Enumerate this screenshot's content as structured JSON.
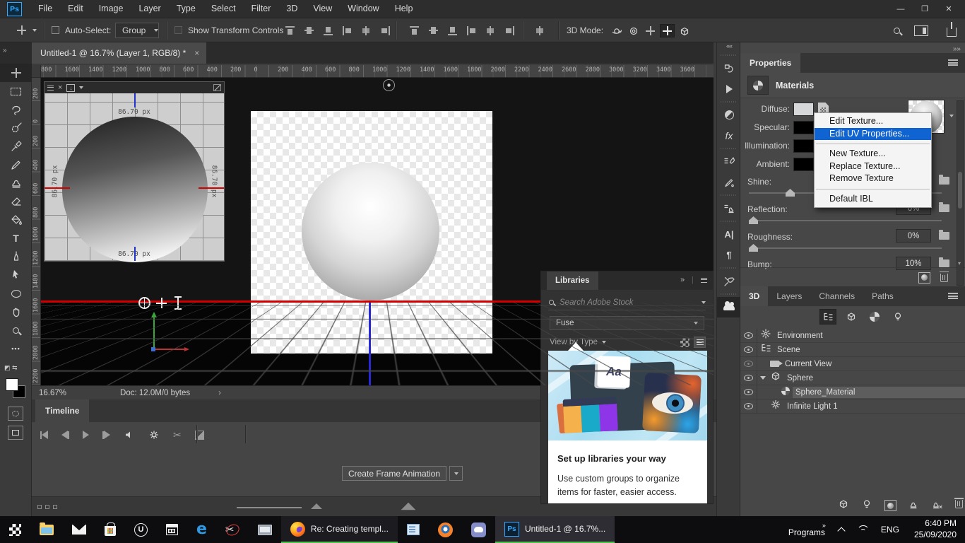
{
  "colors": {
    "menu_highlight_blue": "#0f64d2",
    "taskbar_active_green": "#51c251",
    "photoshop_accent": "#31a8ff",
    "horizon_line_red": "#cf0000",
    "axis_line_blue": "#2828d8"
  },
  "menubar": {
    "logo": "Ps",
    "items": [
      "File",
      "Edit",
      "Image",
      "Layer",
      "Type",
      "Select",
      "Filter",
      "3D",
      "View",
      "Window",
      "Help"
    ],
    "window_controls": [
      "minimize",
      "restore",
      "close"
    ]
  },
  "options_bar": {
    "tool_icon": "move-tool",
    "auto_select_label": "Auto-Select:",
    "auto_select_checked": false,
    "group_value": "Group",
    "show_transform_label": "Show Transform Controls",
    "show_transform_enabled": false,
    "align_icons": [
      "align-top-edges",
      "align-vertical-centers",
      "align-bottom-edges",
      "align-left-edges",
      "align-horizontal-centers",
      "align-right-edges"
    ],
    "distribute_icons": [
      "distribute-top-edges",
      "distribute-vertical-centers",
      "distribute-bottom-edges",
      "distribute-left-edges",
      "distribute-horizontal-centers",
      "distribute-right-edges"
    ],
    "spacing_icon": "distribute-spacing",
    "mode_label": "3D Mode:",
    "mode_icons": [
      "orbit-camera",
      "roll-camera",
      "pan-camera",
      "slide-camera",
      "dolly-camera"
    ],
    "mode_selected": "slide-camera"
  },
  "document_tab": {
    "title": "Untitled-1 @ 16.7% (Layer 1, RGB/8) *",
    "close_glyph": "×"
  },
  "rulers": {
    "horizontal": [
      "800",
      "1600",
      "1400",
      "1200",
      "1000",
      "800",
      "600",
      "400",
      "200",
      "0",
      "200",
      "400",
      "600",
      "800",
      "1000",
      "1200",
      "1400",
      "1600",
      "1800",
      "2000",
      "2200",
      "2400",
      "2600",
      "2800",
      "3000",
      "3200",
      "3400",
      "3600"
    ],
    "vertical": [
      "200",
      "0",
      "200",
      "400",
      "600",
      "800",
      "1000",
      "1200",
      "1400",
      "1600",
      "1800",
      "2000",
      "2200"
    ]
  },
  "toolbar": {
    "tools": [
      "move",
      "rectangular-marquee",
      "lasso",
      "quick-selection",
      "eyedropper",
      "brush",
      "clone-stamp",
      "eraser",
      "paint-bucket",
      "type",
      "pen",
      "path-selection",
      "ellipse",
      "hand",
      "zoom",
      "edit-toolbar"
    ],
    "selected": "move"
  },
  "uv_view": {
    "dim_top": "86.70 px",
    "dim_bottom": "86.70 px",
    "dim_left": "86.70 px",
    "dim_right": "86.70 px"
  },
  "status_bar": {
    "zoom_level": "16.67%",
    "doc_info": "Doc: 12.0M/0 bytes",
    "chevron": "›"
  },
  "timeline_panel": {
    "tab": "Timeline",
    "transport": [
      "first-frame",
      "previous-frame",
      "play",
      "next-frame",
      "mute-audio",
      "settings",
      "split",
      "transition"
    ],
    "create_button_label": "Create Frame Animation"
  },
  "dock_icons": [
    "history",
    "actions",
    "adjustments",
    "styles",
    "brush-settings",
    "brushes",
    "clone-source",
    "character",
    "paragraph",
    "tool-presets",
    "creative-cloud"
  ],
  "properties_panel": {
    "tab": "Properties",
    "section_title": "Materials",
    "material_rows": [
      {
        "label": "Diffuse:",
        "swatch": "#d6d7d9",
        "has_texture_button": true
      },
      {
        "label": "Specular:",
        "swatch": "#000000",
        "has_texture_button": false
      },
      {
        "label": "Illumination:",
        "swatch": "#000000",
        "has_texture_button": false
      },
      {
        "label": "Ambient:",
        "swatch": "#000000",
        "has_texture_button": false
      }
    ],
    "sliders": [
      {
        "label": "Shine:",
        "value": "",
        "thumb_pct": 20
      },
      {
        "label": "Refl​ection:",
        "value": "0%",
        "thumb_pct": 0
      },
      {
        "label": "Roughness:",
        "value": "0%",
        "thumb_pct": 0
      },
      {
        "label": "Bump:",
        "value": "10%",
        "thumb_pct": null
      }
    ]
  },
  "context_menu": {
    "items": [
      {
        "label": "Edit Texture...",
        "highlighted": false
      },
      {
        "label": "Edit UV Properties...",
        "highlighted": true
      },
      {
        "separator": true
      },
      {
        "label": "New Texture...",
        "highlighted": false
      },
      {
        "label": "Replace Texture...",
        "highlighted": false
      },
      {
        "label": "Remove Texture",
        "highlighted": false
      },
      {
        "separator": true
      },
      {
        "label": "Default IBL",
        "highlighted": false
      }
    ]
  },
  "panel_3d": {
    "tabs": [
      "3D",
      "Layers",
      "Channels",
      "Paths"
    ],
    "active_tab": "3D",
    "filter_icons": [
      "scene-tree",
      "meshes",
      "materials",
      "lights"
    ],
    "filter_selected": "scene-tree",
    "tree": [
      {
        "label": "Environment",
        "icon": "environment",
        "indent": 0,
        "eye": "normal",
        "selected": false,
        "expander": null
      },
      {
        "label": "Scene",
        "icon": "scene",
        "indent": 0,
        "eye": "normal",
        "selected": false,
        "expander": null
      },
      {
        "label": "Current View",
        "icon": "camera",
        "indent": 1,
        "eye": "dim",
        "selected": false,
        "expander": null
      },
      {
        "label": "Sphere",
        "icon": "mesh",
        "indent": 0,
        "eye": "normal",
        "selected": false,
        "expander": "open"
      },
      {
        "label": "Sphere_Material",
        "icon": "material",
        "indent": 2,
        "eye": "normal",
        "selected": true,
        "expander": null
      },
      {
        "label": "Infinite Light 1",
        "icon": "light",
        "indent": 1,
        "eye": "normal",
        "selected": false,
        "expander": null
      }
    ],
    "footer_icons": [
      "new-mesh",
      "new-light",
      "add-ibl",
      "new-instance",
      "delete-instance",
      "delete"
    ]
  },
  "libraries_panel": {
    "tab": "Libraries",
    "search_placeholder": "Search Adobe Stock",
    "collection_value": "Fuse",
    "view_by_label": "View by Type",
    "card": {
      "artwork_text": "Aa",
      "title": "Set up libraries your way",
      "body": "Use custom groups to organize items for faster, easier access."
    }
  },
  "taskbar": {
    "apps": [
      {
        "icon": "start-menu"
      },
      {
        "icon": "file-explorer"
      },
      {
        "icon": "mail"
      },
      {
        "icon": "microsoft-store"
      },
      {
        "icon": "unreal-engine"
      },
      {
        "icon": "calendar"
      },
      {
        "icon": "edge"
      },
      {
        "icon": "snipping-tool"
      },
      {
        "icon": "system-monitor"
      },
      {
        "icon": "firefox",
        "label": "Re: Creating templ...",
        "active": true,
        "selected": false
      },
      {
        "icon": "document-viewer"
      },
      {
        "icon": "blender"
      },
      {
        "icon": "discord"
      },
      {
        "icon": "photoshop",
        "label": "Untitled-1 @ 16.7%...",
        "active": true,
        "selected": true
      }
    ],
    "tray": {
      "programs_label": "Programs",
      "language": "ENG",
      "time": "6:40 PM",
      "date": "25/09/2020"
    }
  }
}
